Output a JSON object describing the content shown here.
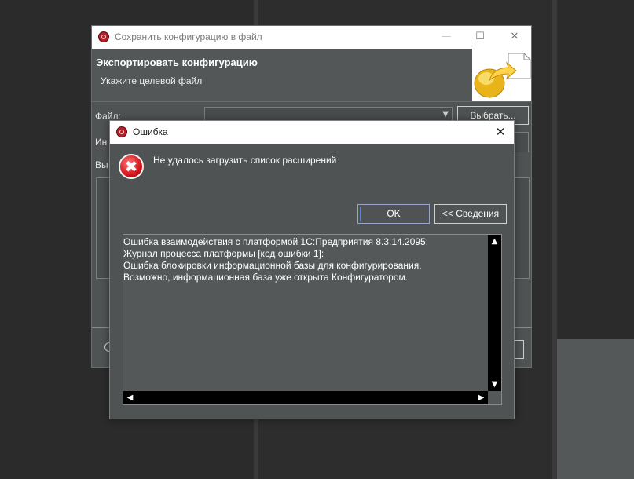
{
  "background_window": {
    "title": "Сохранить конфигурацию в файл",
    "controls": {
      "minimize": "—",
      "maximize": "☐",
      "close": "✕"
    },
    "header": {
      "title": "Экспортировать конфигурацию",
      "subtitle": "Укажите целевой файл"
    },
    "fields": {
      "file_label": "Файл:",
      "second_label_partial": "Ин",
      "third_label_partial": "Вы"
    },
    "buttons": {
      "browse_label": "Выбрать..."
    }
  },
  "error_dialog": {
    "title": "Ошибка",
    "close_symbol": "✕",
    "message": "Не удалось загрузить список расширений",
    "ok_label": "OK",
    "details_prefix": "<< ",
    "details_label": "Сведения",
    "details_lines": [
      "Ошибка взаимодействия с платформой 1С:Предприятия 8.3.14.2095:",
      "Журнал процесса платформы [код ошибки 1]:",
      "Ошибка блокировки информационной базы для конфигурирования.",
      "Возможно, информационная база уже открыта Конфигуратором."
    ],
    "scroll_symbols": {
      "up": "▲",
      "down": "▼",
      "left": "◀",
      "right": "▶"
    }
  },
  "icons": {
    "app_icon": "1c-app-icon",
    "error_icon": "error-icon",
    "wizard_icon": "export-arrow-icon"
  },
  "colors": {
    "panel_bg": "#505354",
    "titlebar_bg": "#ffffff",
    "error_red": "#d1161c",
    "focus_blue": "#5b7fd6"
  }
}
